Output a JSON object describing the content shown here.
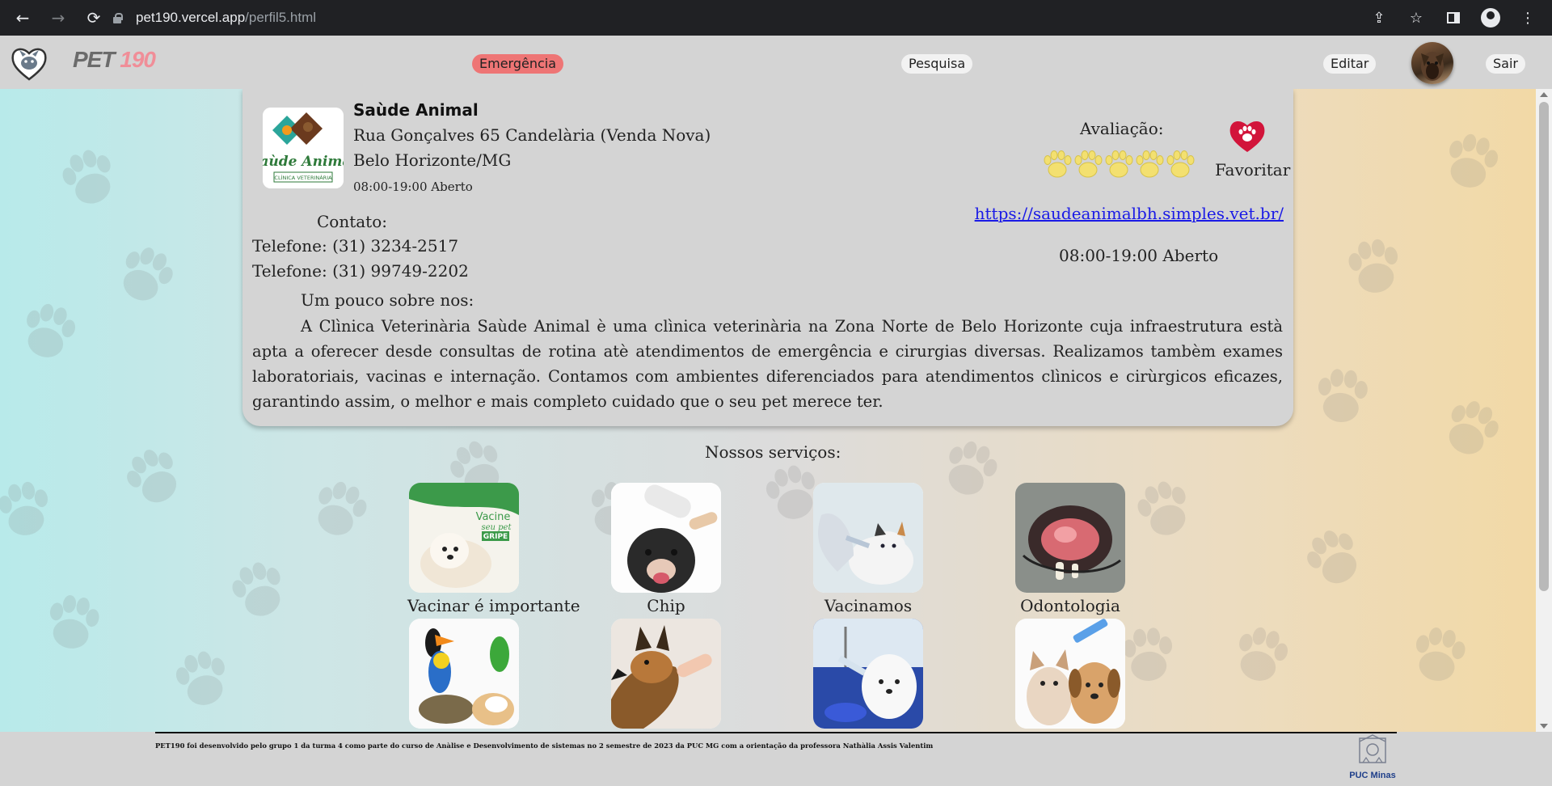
{
  "browser": {
    "url_host": "pet190.vercel.app",
    "url_path": "/perfil5.html",
    "back_icon": "←",
    "forward_icon": "→",
    "reload_icon": "⟳",
    "share_icon": "⇪",
    "star_icon": "☆",
    "menu_icon": "⋮"
  },
  "header": {
    "brand_part1": "PET",
    "brand_part2": "190",
    "emergency_label": "Emergência",
    "search_label": "Pesquisa",
    "edit_label": "Editar",
    "logout_label": "Sair"
  },
  "clinic": {
    "name": "Saùde Animal",
    "address": "Rua Gonçalves 65 Candelària (Venda Nova) Belo Horizonte/MG",
    "hours_small": "08:00-19:00 Aberto",
    "logo_text": "Saùde Animal",
    "logo_subtext": "CLÌNICA VETERINÀRIA",
    "contact_title": "Contato:",
    "phone1": "Telefone: (31) 3234-2517",
    "phone2": "Telefone: (31) 99749-2202",
    "about_title": "Um pouco sobre nos:",
    "about_text": "A Clìnica Veterinària Saùde Animal è uma clìnica veterinària na Zona Norte de Belo Horizonte cuja infraestrutura està apta a oferecer desde consultas de rotina atè atendimentos de emergência e cirurgias diversas. Realizamos tambèm exames laboratoriais, vacinas e internação. Contamos com ambientes diferenciados para atendimentos clìnicos e cirùrgicos eficazes, garantindo assim, o melhor e mais completo cuidado que o seu pet merece ter.",
    "rating_label": "Avaliação:",
    "rating_paws": 5,
    "favorite_label": "Favoritar",
    "website": "https://saudeanimalbh.simples.vet.br/",
    "hours_right": "08:00-19:00 Aberto"
  },
  "services": {
    "title": "Nossos serviços:",
    "items": [
      {
        "label": "Vacinar é importante",
        "image_icon": "puppy-vaccine-icon",
        "badge1": "Vacine",
        "badge2": "seu pet",
        "badge3": "GRIPE"
      },
      {
        "label": "Chip",
        "image_icon": "dog-microchip-icon"
      },
      {
        "label": "Vacinamos",
        "image_icon": "cat-vaccination-icon"
      },
      {
        "label": "Odontologia",
        "image_icon": "dental-exam-icon"
      },
      {
        "label": "",
        "image_icon": "exotic-pets-icon"
      },
      {
        "label": "",
        "image_icon": "german-shepherd-icon"
      },
      {
        "label": "",
        "image_icon": "vet-injection-icon"
      },
      {
        "label": "",
        "image_icon": "cat-dog-syringe-icon"
      }
    ]
  },
  "footer": {
    "text": "PET190 foi desenvolvido pelo grupo 1 da turma 4 como parte do curso de Anàlise e Desenvolvimento de sistemas no 2 semestre de 2023 da PUC MG com a orientação da professora Nathàlia Assis Valentim",
    "puc_label": "PUC Minas"
  },
  "colors": {
    "emergency": "#ee7575",
    "link": "#1a1ae6",
    "paw_gold": "#f3e070",
    "heart": "#d2143a"
  }
}
